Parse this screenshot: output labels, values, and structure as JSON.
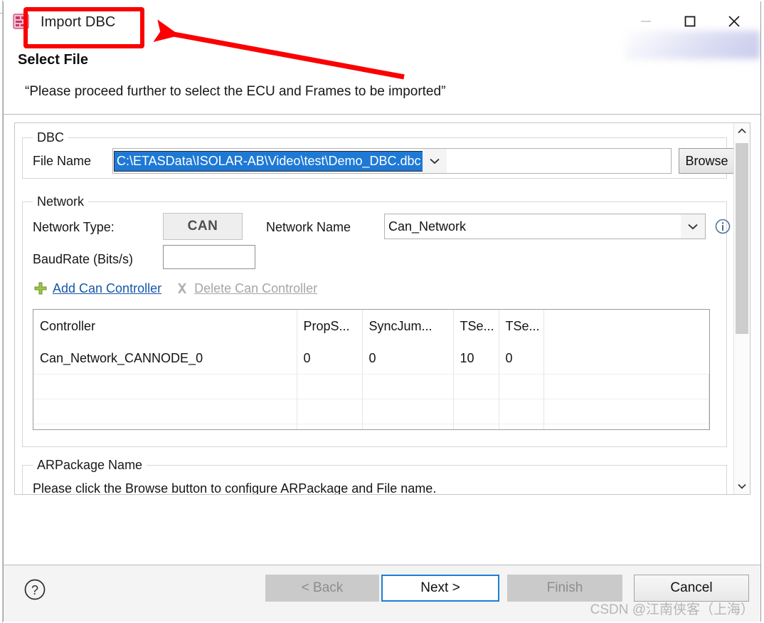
{
  "window": {
    "title": "Import DBC",
    "app_icon": "dbc-file-icon",
    "controls": {
      "minimize": "minimize-icon",
      "maximize": "maximize-icon",
      "close": "close-icon"
    }
  },
  "header": {
    "page_title": "Select File",
    "description": "“Please proceed further to select the ECU and Frames to be imported”"
  },
  "dbc_group": {
    "legend": "DBC",
    "file_name_label": "File Name",
    "file_name_value": "C:\\ETASData\\ISOLAR-AB\\Video\\test\\Demo_DBC.dbc",
    "browse_label": "Browse"
  },
  "network_group": {
    "legend": "Network",
    "network_type_label": "Network Type:",
    "network_type_value": "CAN",
    "network_name_label": "Network Name",
    "network_name_value": "Can_Network",
    "info_icon": "info-icon",
    "baudrate_label": "BaudRate (Bits/s)",
    "baudrate_value": "",
    "actions": [
      {
        "label": "Add Can Controller",
        "icon": "plus-icon",
        "enabled": true
      },
      {
        "label": "Delete Can Controller",
        "icon": "cross-icon",
        "enabled": false
      }
    ],
    "table": {
      "columns": [
        "Controller",
        "PropS...",
        "SyncJum...",
        "TSe...",
        "TSe...",
        ""
      ],
      "rows": [
        [
          "Can_Network_CANNODE_0",
          "0",
          "0",
          "10",
          "0",
          ""
        ]
      ]
    }
  },
  "arpackage_group": {
    "legend": "ARPackage Name",
    "note": "Please click the Browse button to configure ARPackage and File name."
  },
  "footer": {
    "help_icon": "help-icon",
    "buttons": [
      {
        "label": "< Back",
        "state": "disabled"
      },
      {
        "label": "Next >",
        "state": "focus"
      },
      {
        "label": "Finish",
        "state": "disabled"
      },
      {
        "label": "Cancel",
        "state": "normal"
      }
    ]
  },
  "watermark": "CSDN @江南侠客（上海）",
  "annotation": {
    "highlight_color": "#fb0000",
    "target": "window-title"
  }
}
